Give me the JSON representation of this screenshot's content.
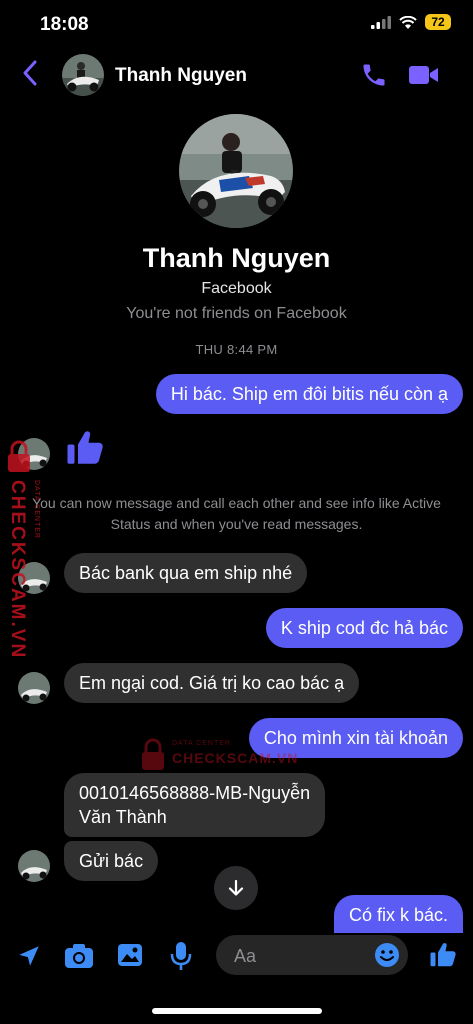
{
  "status_bar": {
    "time": "18:08",
    "battery": "72"
  },
  "header": {
    "contact_name": "Thanh Nguyen"
  },
  "profile": {
    "name": "Thanh Nguyen",
    "platform": "Facebook",
    "relationship_note": "You're not friends on Facebook"
  },
  "conversation": {
    "timestamp": "THU 8:44 PM",
    "system_message": "You can now message and call each other and see info like Active Status and when you've read messages.",
    "messages": [
      {
        "direction": "outgoing",
        "text": "Hi bác. Ship em đôi bitis nếu còn ạ"
      },
      {
        "direction": "incoming",
        "type": "like"
      },
      {
        "direction": "incoming",
        "text": "Bác bank qua em ship nhé"
      },
      {
        "direction": "outgoing",
        "text": "K ship cod đc hả bác"
      },
      {
        "direction": "incoming",
        "text": "Em ngại cod. Giá trị ko cao bác ạ"
      },
      {
        "direction": "outgoing",
        "text": "Cho mình xin tài khoản"
      },
      {
        "direction": "incoming",
        "text_line1": "0010146568888-MB-Nguyễn",
        "text_line2": "Văn Thành"
      },
      {
        "direction": "incoming",
        "text": "Gửi bác"
      },
      {
        "direction": "outgoing",
        "text": "Có fix k bác."
      }
    ]
  },
  "composer": {
    "placeholder": "Aa"
  },
  "watermark": {
    "brand": "CHECKSCAM.VN",
    "tagline": "DATA CENTER"
  },
  "colors": {
    "accent": "#5b5cf3",
    "incoming_bubble": "#303030",
    "watermark": "#c1121f"
  }
}
